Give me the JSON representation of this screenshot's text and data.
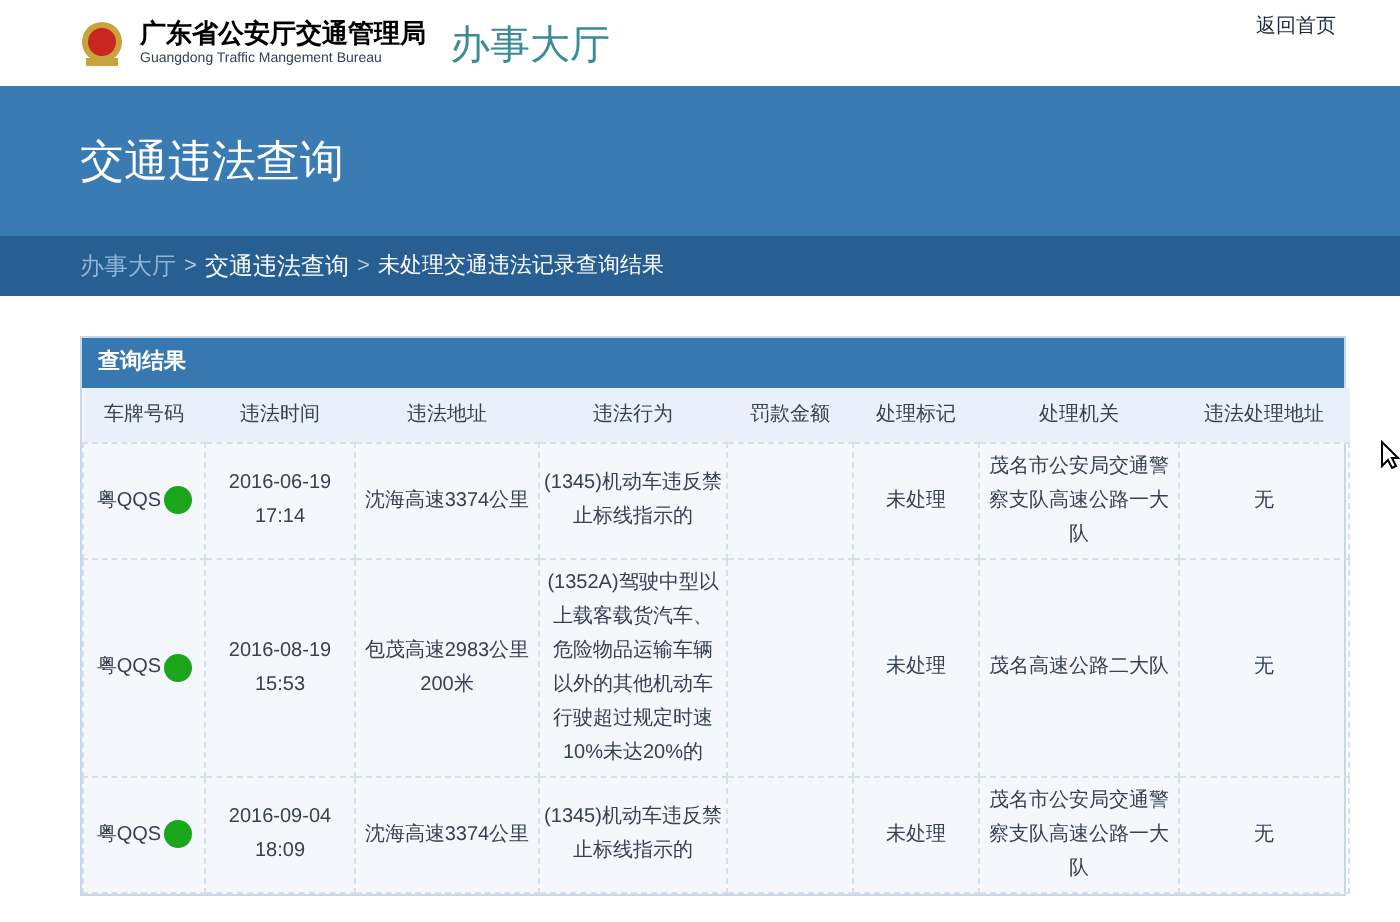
{
  "header": {
    "logo_title": "广东省公安厅交通管理局",
    "logo_subtitle": "Guangdong Traffic Mangement Bureau",
    "site_name": "办事大厅",
    "home_link": "返回首页"
  },
  "banner": {
    "title": "交通违法查询"
  },
  "breadcrumb": [
    {
      "label": "办事大厅",
      "current": false
    },
    {
      "label": "交通违法查询",
      "current": false
    },
    {
      "label": "未处理交通违法记录查询结果",
      "current": true
    }
  ],
  "breadcrumb_separator": ">",
  "panel": {
    "title": "查询结果"
  },
  "table": {
    "columns": [
      "车牌号码",
      "违法时间",
      "违法地址",
      "违法行为",
      "罚款金额",
      "处理标记",
      "处理机关",
      "违法处理地址"
    ],
    "rows": [
      [
        "粤QQS",
        "2016-06-19 17:14",
        "沈海高速3374公里",
        "(1345)机动车违反禁止标线指示的",
        "",
        "未处理",
        "茂名市公安局交通警察支队高速公路一大队",
        "无"
      ],
      [
        "粤QQS",
        "2016-08-19 15:53",
        "包茂高速2983公里200米",
        "(1352A)驾驶中型以上载客载货汽车、危险物品运输车辆以外的其他机动车行驶超过规定时速10%未达20%的",
        "",
        "未处理",
        "茂名高速公路二大队",
        "无"
      ],
      [
        "粤QQS",
        "2016-09-04 18:09",
        "沈海高速3374公里",
        "(1345)机动车违反禁止标线指示的",
        "",
        "未处理",
        "茂名市公安局交通警察支队高速公路一大队",
        "无"
      ]
    ]
  }
}
